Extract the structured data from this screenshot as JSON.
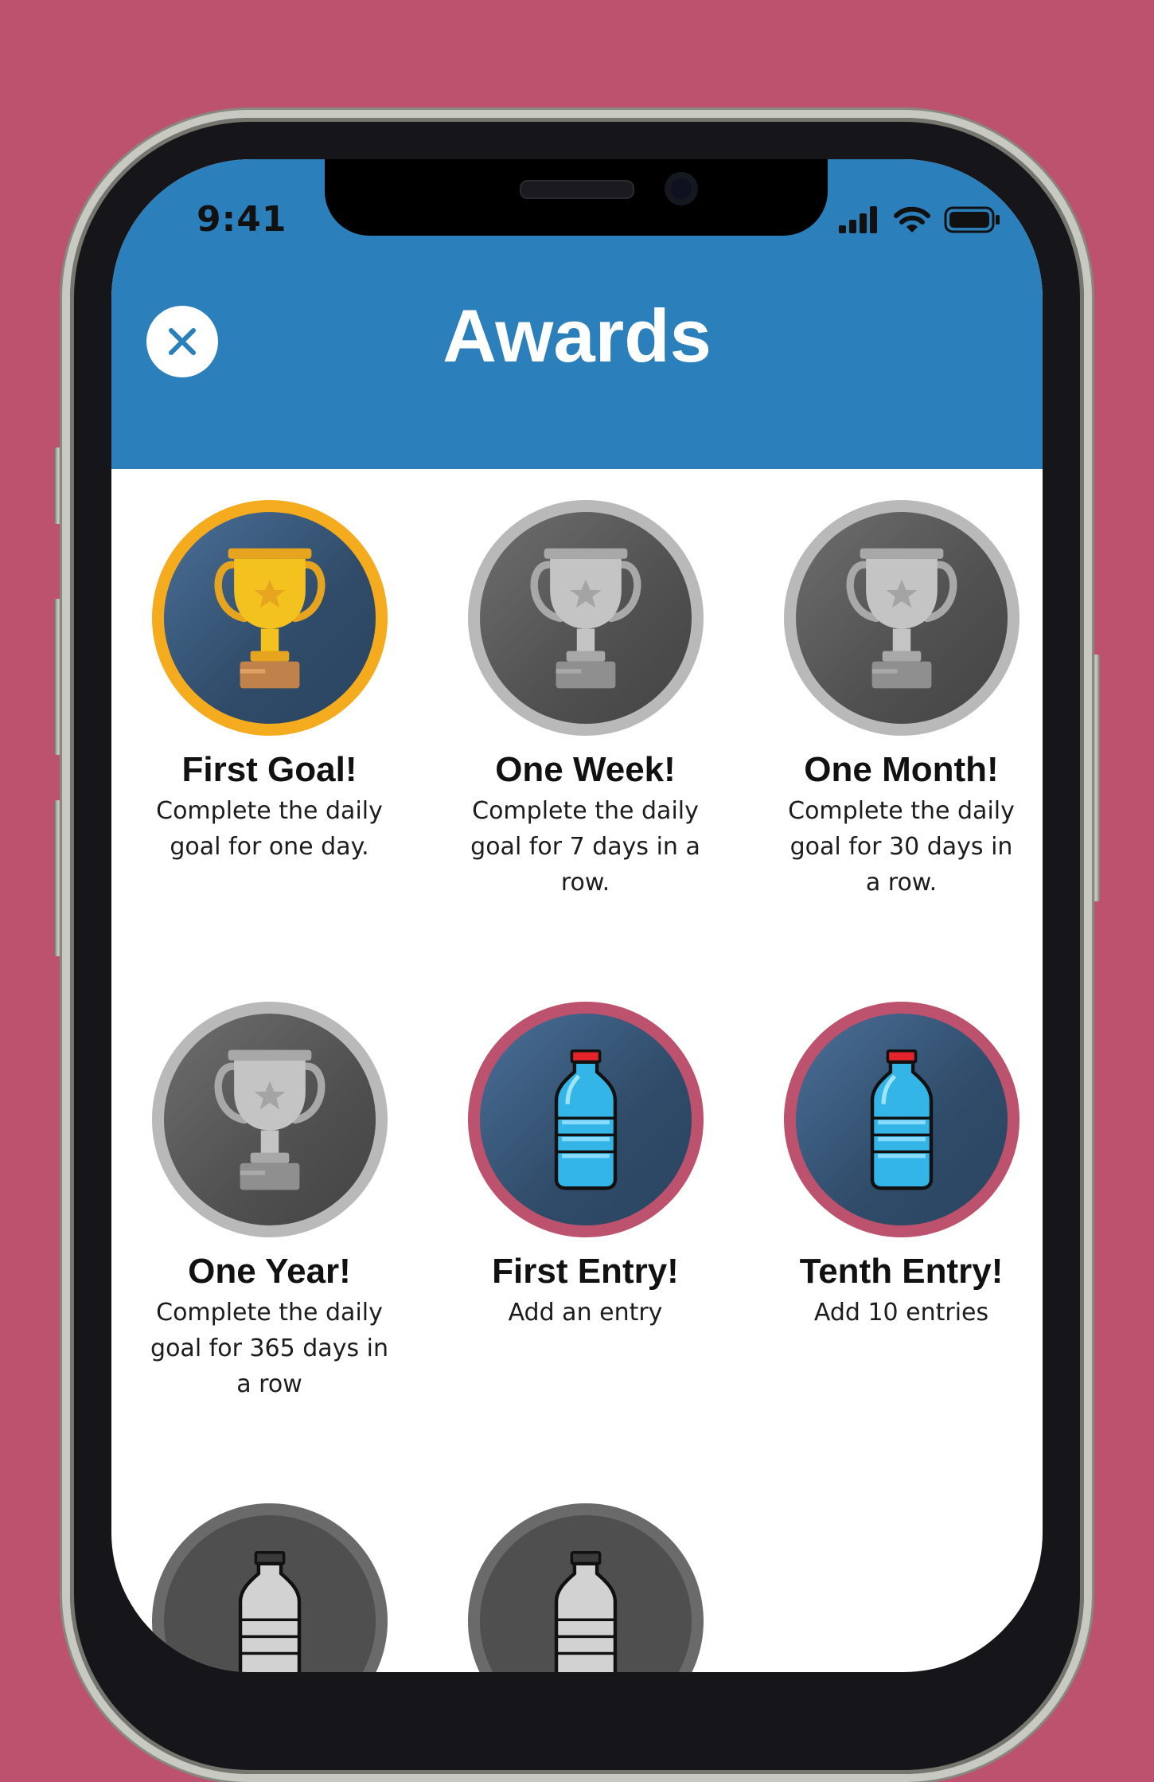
{
  "colors": {
    "background": "#BC526E",
    "header": "#2B7FBB",
    "gold_ring": "#F5AB1E",
    "pink_ring": "#BC526E",
    "locked_ring": "#B9B9B9"
  },
  "status_bar": {
    "time": "9:41",
    "icons": [
      "signal-bars-icon",
      "wifi-icon",
      "battery-icon"
    ]
  },
  "header": {
    "title": "Awards",
    "close_icon": "close-x-icon"
  },
  "awards": [
    {
      "title": "First Goal!",
      "description": "Complete the daily goal for one day.",
      "icon": "trophy-icon",
      "state": "earned"
    },
    {
      "title": "One Week!",
      "description": "Complete the daily goal for 7 days in a row.",
      "icon": "trophy-icon",
      "state": "locked"
    },
    {
      "title": "One Month!",
      "description": "Complete the daily goal for 30 days in a row.",
      "icon": "trophy-icon",
      "state": "locked"
    },
    {
      "title": "One Year!",
      "description": "Complete the daily goal for 365 days in a row",
      "icon": "trophy-icon",
      "state": "locked"
    },
    {
      "title": "First Entry!",
      "description": "Add an entry",
      "icon": "water-bottle-icon",
      "state": "earned"
    },
    {
      "title": "Tenth Entry!",
      "description": "Add 10 entries",
      "icon": "water-bottle-icon",
      "state": "earned"
    },
    {
      "title": "",
      "description": "",
      "icon": "water-bottle-icon",
      "state": "locked"
    },
    {
      "title": "",
      "description": "",
      "icon": "water-bottle-icon",
      "state": "locked"
    }
  ]
}
